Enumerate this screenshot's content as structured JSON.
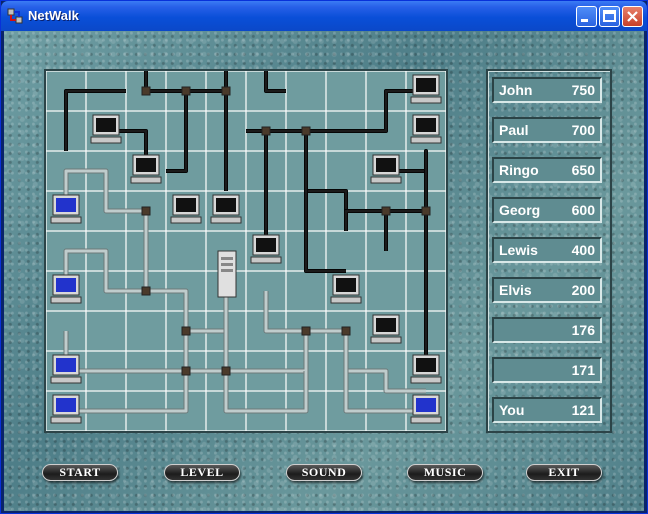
{
  "window": {
    "title": "NetWalk"
  },
  "scores": [
    {
      "name": "John",
      "value": "750"
    },
    {
      "name": "Paul",
      "value": "700"
    },
    {
      "name": "Ringo",
      "value": "650"
    },
    {
      "name": "Georg",
      "value": "600"
    },
    {
      "name": "Lewis",
      "value": "400"
    },
    {
      "name": "Elvis",
      "value": "200"
    },
    {
      "name": "",
      "value": "176"
    },
    {
      "name": "",
      "value": "171"
    },
    {
      "name": "You",
      "value": "121"
    }
  ],
  "buttons": {
    "start": "START",
    "level": "LEVEL",
    "sound": "SOUND",
    "music": "MUSIC",
    "exit": "EXIT"
  },
  "colors": {
    "board_cell": "#6f9c9f",
    "grid_line": "#ffffff",
    "cable_dark": "#1b1b1b",
    "cable_connected": "#bfcccc",
    "terminal_on": "#2233cc",
    "terminal_off": "#111111",
    "title_bar": "#0a4fd8"
  },
  "icons": [
    "netwalk-app-icon",
    "minimize-icon",
    "maximize-icon",
    "close-icon",
    "server-icon",
    "terminal-icon"
  ]
}
